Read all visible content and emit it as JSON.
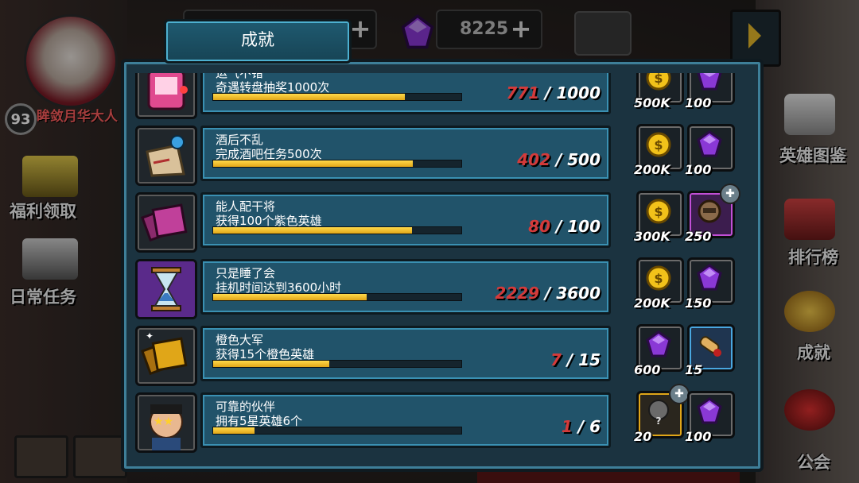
{
  "player": {
    "level": "93",
    "name": "眸敛月华大人"
  },
  "resources": {
    "gems": "8225"
  },
  "left_menu": [
    {
      "label": "福利领取"
    },
    {
      "label": "日常任务"
    }
  ],
  "right_menu": [
    {
      "label": "英雄图鉴"
    },
    {
      "label": "排行榜"
    },
    {
      "label": "成就"
    },
    {
      "label": "公会"
    }
  ],
  "panel": {
    "title": "成就"
  },
  "achievements": [
    {
      "name": "运气不错",
      "desc": "奇遇转盘抽奖1000次",
      "current": "771",
      "total": "1000",
      "progress": 0.771,
      "icon": "slot-machine-icon",
      "icon_color": "#e04a8f",
      "rewards": [
        {
          "icon": "gold-coin-icon",
          "amount": "500K"
        },
        {
          "icon": "purple-gem-icon",
          "amount": "100"
        }
      ]
    },
    {
      "name": "酒后不乱",
      "desc": "完成酒吧任务500次",
      "current": "402",
      "total": "500",
      "progress": 0.804,
      "icon": "pinned-note-icon",
      "icon_color": "#d9c19a",
      "rewards": [
        {
          "icon": "gold-coin-icon",
          "amount": "200K"
        },
        {
          "icon": "purple-gem-icon",
          "amount": "100"
        }
      ]
    },
    {
      "name": "能人配干将",
      "desc": "获得100个紫色英雄",
      "current": "80",
      "total": "100",
      "progress": 0.8,
      "icon": "purple-cards-icon",
      "icon_color": "#b0328c",
      "rewards": [
        {
          "icon": "gold-coin-icon",
          "amount": "300K"
        },
        {
          "icon": "hero-fragment-icon",
          "amount": "250"
        }
      ]
    },
    {
      "name": "只是睡了会",
      "desc": "挂机时间达到3600小时",
      "current": "2229",
      "total": "3600",
      "progress": 0.619,
      "icon": "hourglass-icon",
      "icon_color": "#7a3fb8",
      "rewards": [
        {
          "icon": "gold-coin-icon",
          "amount": "200K"
        },
        {
          "icon": "purple-gem-icon",
          "amount": "150"
        }
      ]
    },
    {
      "name": "橙色大军",
      "desc": "获得15个橙色英雄",
      "current": "7",
      "total": "15",
      "progress": 0.467,
      "icon": "orange-cards-icon",
      "icon_color": "#d99a1c",
      "rewards": [
        {
          "icon": "purple-gem-icon",
          "amount": "600"
        },
        {
          "icon": "scroll-icon",
          "amount": "15"
        }
      ]
    },
    {
      "name": "可靠的伙伴",
      "desc": "拥有5星英雄6个",
      "current": "1",
      "total": "6",
      "progress": 0.167,
      "icon": "star-hero-icon",
      "icon_color": "#c75b2a",
      "rewards": [
        {
          "icon": "mystery-fragment-icon",
          "amount": "20"
        },
        {
          "icon": "purple-gem-icon",
          "amount": "100"
        }
      ]
    }
  ],
  "colors": {
    "panel_bg": "#1b3340",
    "row_bg": "#21536a",
    "bar_fill": "#e0a618",
    "current_count": "#d43a3a"
  }
}
